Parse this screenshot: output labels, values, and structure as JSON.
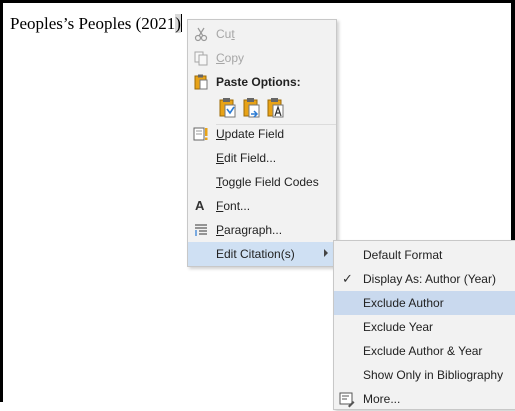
{
  "document": {
    "text_before": "Peoples’s Peoples (2021",
    "text_field": ")"
  },
  "context_menu": {
    "cut": "Cut",
    "copy": "Copy",
    "paste_options": "Paste Options:",
    "update_field": "Update Field",
    "edit_field": "Edit Field...",
    "toggle_field_codes": "Toggle Field Codes",
    "font": "Font...",
    "paragraph": "Paragraph...",
    "edit_citations": "Edit Citation(s)",
    "font_icon_glyph": "A"
  },
  "citation_submenu": {
    "default_format": "Default Format",
    "display_as": "Display As: Author (Year)",
    "exclude_author": "Exclude Author",
    "exclude_year": "Exclude Year",
    "exclude_author_year": "Exclude Author & Year",
    "show_only_bibliography": "Show Only in Bibliography",
    "more": "More...",
    "check_glyph": "✓"
  },
  "icons": {
    "cut": "scissors-icon",
    "copy": "copy-icon",
    "paste": "clipboard-icon",
    "paste_keep_source": "paste-keep-source-icon",
    "paste_merge": "paste-merge-icon",
    "paste_text_only": "paste-text-only-icon",
    "update_field": "update-field-icon",
    "font": "font-icon",
    "paragraph": "paragraph-icon",
    "more": "citation-more-icon"
  },
  "colors": {
    "menu_bg": "#f2f2f2",
    "highlight": "#c9d9ee",
    "disabled_text": "#a6a6a6",
    "icon_orange": "#e8a317",
    "icon_blue": "#2b7bd4"
  }
}
